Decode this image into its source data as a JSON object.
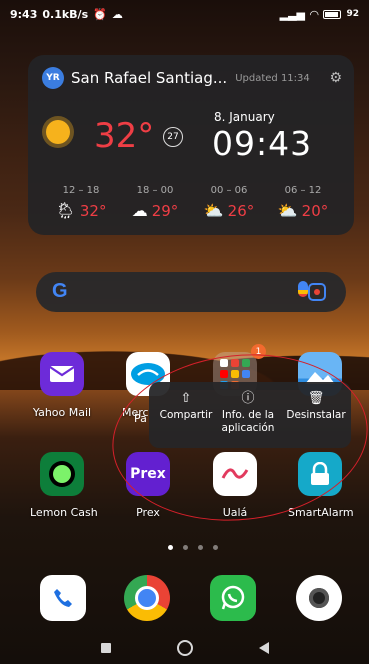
{
  "status_bar": {
    "time": "9:43",
    "speed": "0.1kB/s",
    "battery": "92"
  },
  "weather": {
    "logo": "YR",
    "location": "San Rafael Santiag...",
    "updated": "Updated 11:34",
    "temperature": "32°",
    "aqi": "27",
    "date": "8. January",
    "time": "09:43",
    "forecast": [
      {
        "range": "12 – 18",
        "temp": "32°",
        "icon": "rain-sun-icon"
      },
      {
        "range": "18 – 00",
        "temp": "29°",
        "icon": "cloud-icon"
      },
      {
        "range": "00 – 06",
        "temp": "26°",
        "icon": "partly-cloudy-night-icon"
      },
      {
        "range": "06 – 12",
        "temp": "20°",
        "icon": "partly-cloudy-icon"
      }
    ]
  },
  "apps_row1": [
    {
      "label": "Yahoo Mail"
    },
    {
      "label": "Merc"
    },
    {
      "label": "",
      "badge": "1"
    },
    {
      "label": ""
    }
  ],
  "merc_label_line2": "Pa",
  "popup": {
    "share": "Compartir",
    "info_line1": "Info. de la",
    "info_line2": "aplicación",
    "uninstall": "Desinstalar"
  },
  "apps_row2": [
    {
      "label": "Lemon Cash"
    },
    {
      "label": "Prex",
      "icon_text": "Prex"
    },
    {
      "label": "Ualá"
    },
    {
      "label": "SmartAlarm"
    }
  ],
  "colors": {
    "temp_red": "#ef3e45",
    "annotation_red": "#d4202a"
  }
}
